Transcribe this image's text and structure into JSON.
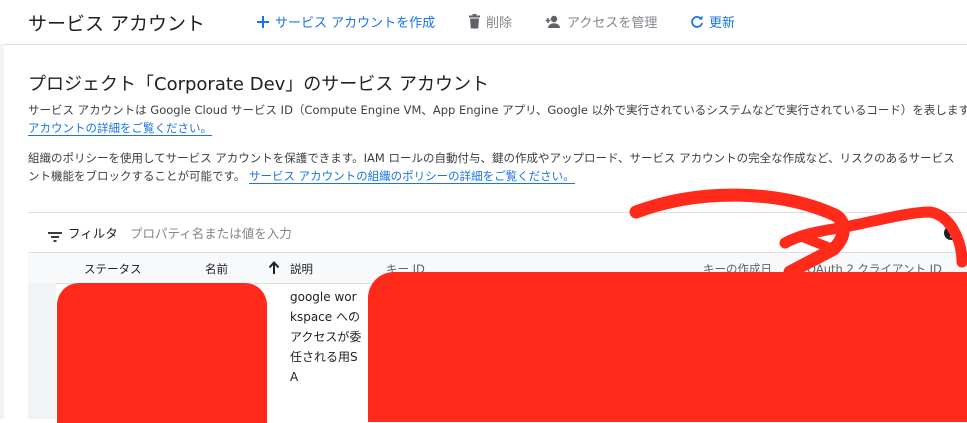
{
  "header": {
    "title": "サービス アカウント",
    "create_label": "サービス アカウントを作成",
    "delete_label": "削除",
    "manage_access_label": "アクセスを管理",
    "refresh_label": "更新"
  },
  "main": {
    "heading": "プロジェクト「Corporate Dev」のサービス アカウント",
    "para1_line1": "サービス アカウントは Google Cloud サービス ID（Compute Engine VM、App Engine アプリ、Google 以外で実行されているシステムなどで実行されているコード）を表します。",
    "para1_link": "アカウントの詳細をご覧ください。",
    "para2_line1": "組織のポリシーを使用してサービス アカウントを保護できます。IAM ロールの自動付与、鍵の作成やアップロード、サービス アカウントの完全な作成など、リスクのあるサービス",
    "para2_line2": "ント機能をブロックすることが可能です。",
    "para2_link": "サービス アカウントの組織のポリシーの詳細をご覧ください。"
  },
  "filter": {
    "label": "フィルタ",
    "placeholder": "プロパティ名または値を入力"
  },
  "table": {
    "columns": {
      "status": "ステータス",
      "name": "名前",
      "description": "説明",
      "key_id": "キー ID",
      "key_created": "キーの作成日",
      "oauth_client_id": "OAuth 2 クライアント ID"
    },
    "rows": [
      {
        "description": "google workspace へのアクセスが委任される用SA"
      }
    ]
  },
  "colors": {
    "primary": "#1a73e8",
    "redaction": "#ff2a1a"
  }
}
